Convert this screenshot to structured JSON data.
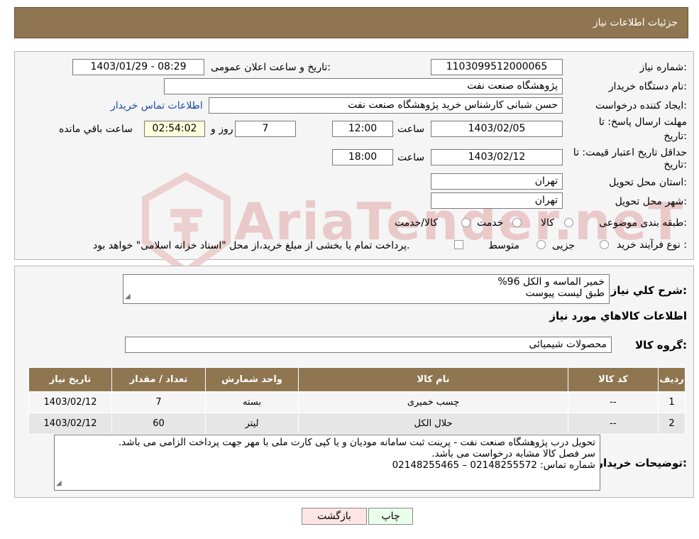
{
  "header": {
    "title": "جزئیات اطلاعات نیاز"
  },
  "form": {
    "need_number_label": "شماره نیاز:",
    "need_number": "1103099512000065",
    "announce_label": "تاریخ و ساعت اعلان عمومی:",
    "announce_value": "1403/01/29 - 08:29",
    "buyer_org_label": "نام دستگاه خریدار:",
    "buyer_org": "پژوهشگاه صنعت نفت",
    "requester_label": "ایجاد کننده درخواست:",
    "requester": "حسن شبانی کارشناس خرید پژوهشگاه صنعت نفت",
    "contact_link": "اطلاعات تماس خریدار",
    "deadline_label_1": "مهلت ارسال پاسخ: تا",
    "deadline_label_2": "تاریخ:",
    "deadline_date": "1403/02/05",
    "time_label": "ساعت",
    "deadline_time": "12:00",
    "days_value": "7",
    "days_label": "روز و",
    "remaining_time": "02:54:02",
    "remaining_label": "ساعت باقي مانده",
    "validity_label_1": "حداقل تاریخ اعتبار قیمت: تا",
    "validity_label_2": "تاریخ:",
    "validity_date": "1403/02/12",
    "validity_time": "18:00",
    "province_label": "استان محل تحویل:",
    "province": "تهران",
    "city_label": "شهر محل تحویل:",
    "city": "تهران",
    "category_label": "طبقه بندی موضوعی:",
    "category_options": [
      "کالا",
      "خدمت",
      "کالا/خدمت"
    ],
    "process_label": "نوع فرآیند خرید :",
    "process_options": [
      "جزیی",
      "متوسط"
    ],
    "process_note": "پرداخت تمام یا بخشی از مبلغ خرید،از محل \"اسناد خزانه اسلامی\" خواهد بود."
  },
  "summary": {
    "label": "شرح کلي نياز:",
    "line1": "خمیر الماسه و الکل 96%",
    "line2": "طبق لیست پیوست"
  },
  "goods_section": {
    "title": "اطلاعات کالاهاي مورد نياز",
    "group_label": "گروه کالا:",
    "group_value": "محصولات شیمیائی"
  },
  "table": {
    "headers": [
      "رديف",
      "کد کالا",
      "نام کالا",
      "واحد شمارش",
      "تعداد / مقدار",
      "تاريخ نياز"
    ],
    "rows": [
      {
        "idx": "1",
        "code": "--",
        "name": "چسب خمیری",
        "unit": "بسته",
        "qty": "7",
        "date": "1403/02/12"
      },
      {
        "idx": "2",
        "code": "--",
        "name": "حلال الکل",
        "unit": "لیتر",
        "qty": "60",
        "date": "1403/02/12"
      }
    ]
  },
  "buyer_notes": {
    "label": "توضیحات خریدار:",
    "line1": "تحویل درب پژوهشگاه صنعت نفت - پرینت ثبت سامانه مودیان و یا کپی کارت ملی با مهر جهت پرداخت الزامی می باشد.",
    "line2": "سر فصل کالا مشابه درخواست می باشد.",
    "line3": "شماره تماس: 02148255572 – 02148255465"
  },
  "buttons": {
    "print": "چاپ",
    "back": "بازگشت"
  },
  "watermark": "AriaTender.neT",
  "colors": {
    "header_bg": "#8f7650",
    "back_button_bg": "#ffe5e5",
    "print_button_bg": "#eaffea",
    "remaining_bg": "#ffffdd",
    "link": "#1a4aa8"
  }
}
